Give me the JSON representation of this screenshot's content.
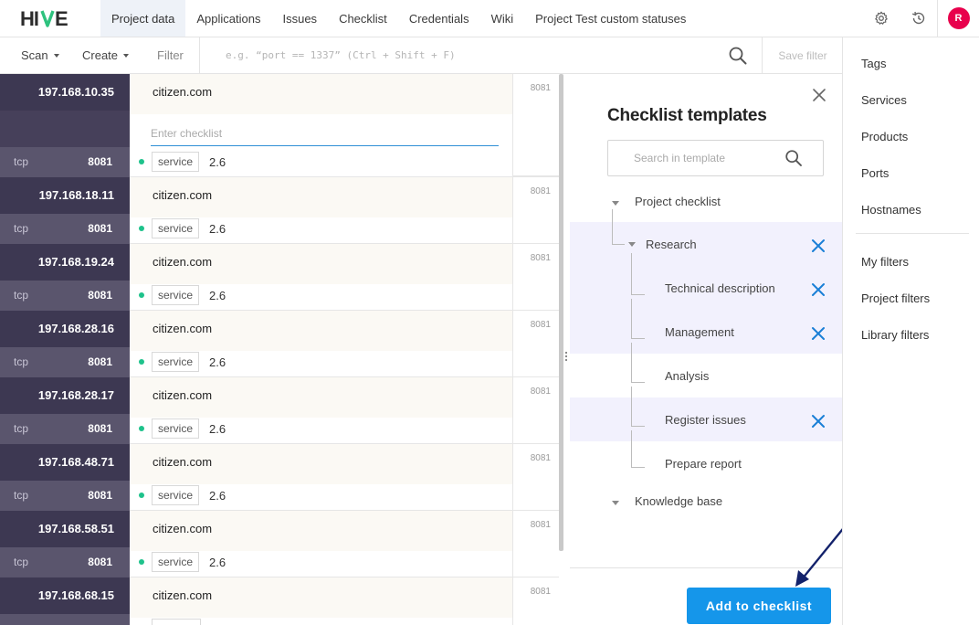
{
  "app": {
    "logo_text": "HIVE",
    "avatar_letter": "R",
    "nav_tabs": [
      {
        "label": "Project data"
      },
      {
        "label": "Applications"
      },
      {
        "label": "Issues"
      },
      {
        "label": "Checklist"
      },
      {
        "label": "Credentials"
      },
      {
        "label": "Wiki"
      },
      {
        "label": "Project Test custom statuses"
      }
    ],
    "icons": [
      "gear-icon",
      "history-icon"
    ]
  },
  "toolbar": {
    "scan_label": "Scan",
    "create_label": "Create",
    "filter_label": "Filter",
    "filter_placeholder": "e.g. “port == 1337” (Ctrl + Shift + F)",
    "save_filter_label": "Save filter"
  },
  "records": [
    {
      "ip": "197.168.10.35",
      "host": "citizen.com",
      "proto": "tcp",
      "port": "8081",
      "side_port": "8081",
      "tag": "service",
      "version": "2.6",
      "checklist_placeholder": "Enter checklist"
    },
    {
      "ip": "197.168.18.11",
      "host": "citizen.com",
      "proto": "tcp",
      "port": "8081",
      "side_port": "8081",
      "tag": "service",
      "version": "2.6"
    },
    {
      "ip": "197.168.19.24",
      "host": "citizen.com",
      "proto": "tcp",
      "port": "8081",
      "side_port": "8081",
      "tag": "service",
      "version": "2.6"
    },
    {
      "ip": "197.168.28.16",
      "host": "citizen.com",
      "proto": "tcp",
      "port": "8081",
      "side_port": "8081",
      "tag": "service",
      "version": "2.6"
    },
    {
      "ip": "197.168.28.17",
      "host": "citizen.com",
      "proto": "tcp",
      "port": "8081",
      "side_port": "8081",
      "tag": "service",
      "version": "2.6"
    },
    {
      "ip": "197.168.48.71",
      "host": "citizen.com",
      "proto": "tcp",
      "port": "8081",
      "side_port": "8081",
      "tag": "service",
      "version": "2.6"
    },
    {
      "ip": "197.168.58.51",
      "host": "citizen.com",
      "proto": "tcp",
      "port": "8081",
      "side_port": "8081",
      "tag": "service",
      "version": "2.6"
    },
    {
      "ip": "197.168.68.15",
      "host": "citizen.com",
      "side_port": "8081"
    }
  ],
  "panel": {
    "title": "Checklist templates",
    "search_placeholder": "Search in template",
    "tree": {
      "project_checklist": "Project checklist",
      "research": "Research",
      "technical_description": "Technical description",
      "management": "Management",
      "analysis": "Analysis",
      "register_issues": "Register issues",
      "prepare_report": "Prepare report",
      "knowledge_base": "Knowledge base"
    },
    "add_button": "Add to checklist",
    "highlight_color": "#f2f1fd",
    "button_color": "#1596ea"
  },
  "sidebar": {
    "items": [
      {
        "label": "Tags"
      },
      {
        "label": "Services"
      },
      {
        "label": "Products"
      },
      {
        "label": "Ports"
      },
      {
        "label": "Hostnames"
      },
      {
        "label": "My filters"
      },
      {
        "label": "Project filters"
      },
      {
        "label": "Library filters"
      }
    ]
  }
}
